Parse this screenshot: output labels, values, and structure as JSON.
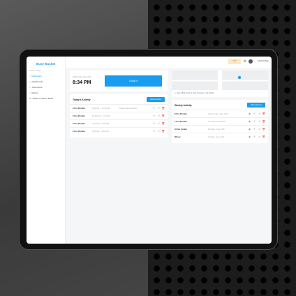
{
  "app": {
    "logo": "Busy Bucket",
    "user": "Arturi Seritson",
    "trial": "Trial"
  },
  "sidebar": {
    "section": "Time Tracking",
    "items": [
      {
        "label": "Dashboard",
        "icon": "grid-icon"
      },
      {
        "label": "Attachments",
        "icon": "attachment-icon"
      },
      {
        "label": "Comments",
        "icon": "comment-icon"
      },
      {
        "label": "History",
        "icon": "history-icon"
      },
      {
        "label": "Switch to Admin Mode",
        "icon": "switch-icon"
      }
    ]
  },
  "clock": {
    "date": "Wednesday, June 27th",
    "time": "8:34 PM",
    "button": "Clock In"
  },
  "location": {
    "address": "Near 1833 Irving St, San Francisco, CA 94122"
  },
  "today": {
    "title": "Today's Activity",
    "button": "Manual Entry",
    "rows": [
      {
        "duration": "2 hrs 30 mins",
        "range": "8:00 AM – 10:30 AM",
        "note": "Project Name Started"
      },
      {
        "duration": "2 hrs 30 mins",
        "range": "10:00 AM – 1:30 PM",
        "note": ""
      },
      {
        "duration": "2 hrs 30 mins",
        "range": "3:00 PM – 6:00 PM",
        "note": ""
      },
      {
        "duration": "2 hrs 30 mins",
        "range": "6:00 AM – 6:30 AM",
        "note": ""
      }
    ]
  },
  "weekly": {
    "title": "Weekly Activity",
    "button": "Manual Entry",
    "rows": [
      {
        "duration": "8 hrs 30 mins",
        "day": "Wednesday, June 27th"
      },
      {
        "duration": "7 hrs 30 mins",
        "day": "Tuesday, June 26th"
      },
      {
        "duration": "10 hrs 2 mins",
        "day": "Monday, June 25th"
      },
      {
        "duration": "58 sec",
        "day": "Sunday, June 24th"
      }
    ]
  }
}
